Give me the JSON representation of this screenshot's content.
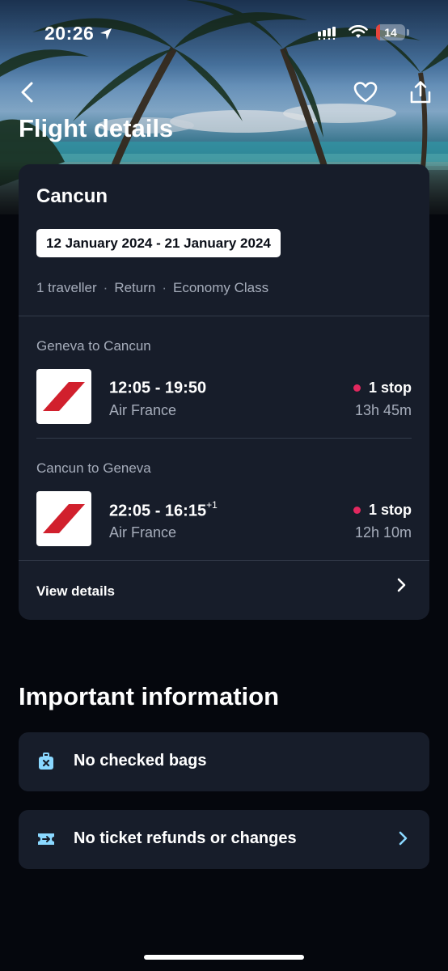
{
  "status_bar": {
    "time": "20:26",
    "battery_level": "14",
    "battery_fraction": 0.14
  },
  "header": {
    "title": "Flight details",
    "back_icon": "chevron-left-icon",
    "favorite_icon": "heart-icon",
    "share_icon": "share-icon"
  },
  "trip": {
    "destination": "Cancun",
    "dates": "12 January 2024 - 21 January 2024",
    "travellers": "1 traveller",
    "trip_type": "Return",
    "cabin": "Economy Class",
    "separator": "·"
  },
  "legs": [
    {
      "label": "Geneva to Cancun",
      "times": "12:05 - 19:50",
      "day_offset": "",
      "airline": "Air France",
      "stops": "1 stop",
      "duration": "13h 45m"
    },
    {
      "label": "Cancun to Geneva",
      "times": "22:05 - 16:15",
      "day_offset": "+1",
      "airline": "Air France",
      "stops": "1 stop",
      "duration": "12h 10m"
    }
  ],
  "view_details_label": "View details",
  "important": {
    "title": "Important information",
    "items": [
      {
        "label": "No checked bags",
        "icon": "no-bag-icon"
      },
      {
        "label": "No ticket refunds or changes",
        "icon": "no-ticket-icon"
      }
    ]
  },
  "colors": {
    "background": "#05070d",
    "card": "#171d2a",
    "muted_text": "#a6adbb",
    "stop_dot": "#e2285f",
    "airline_red": "#d1202d",
    "info_icon": "#8ad8ff"
  }
}
